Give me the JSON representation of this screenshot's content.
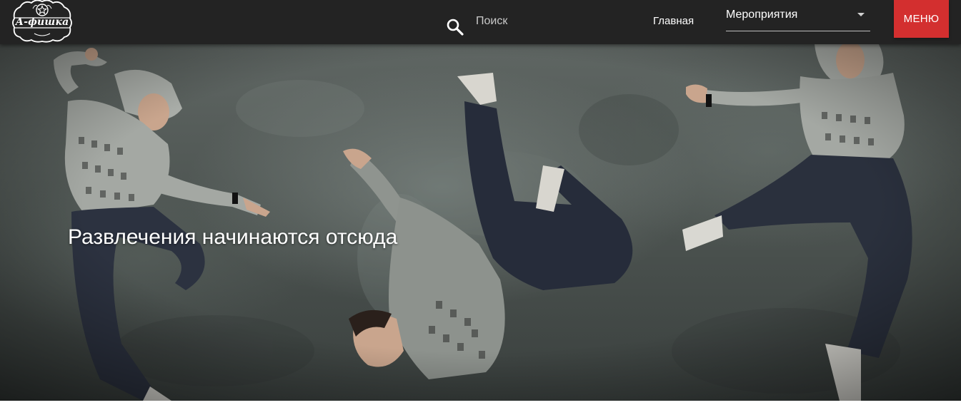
{
  "header": {
    "logo": {
      "text": "А-фишка",
      "icon": "star-emblem-icon"
    },
    "search": {
      "placeholder": "Поиск",
      "icon": "search-icon"
    },
    "nav": {
      "home_label": "Главная"
    },
    "category_select": {
      "selected": "Мероприятия",
      "icon": "caret-down-icon"
    },
    "menu_button": {
      "label": "МЕНЮ",
      "color": "#d32f2f"
    }
  },
  "hero": {
    "title": "Развлечения начинаются отсюда",
    "image": "three-breakdancers-photo"
  },
  "colors": {
    "header_bg": "#232323",
    "accent": "#d32f2f",
    "hero_bg": "#4e5552"
  }
}
